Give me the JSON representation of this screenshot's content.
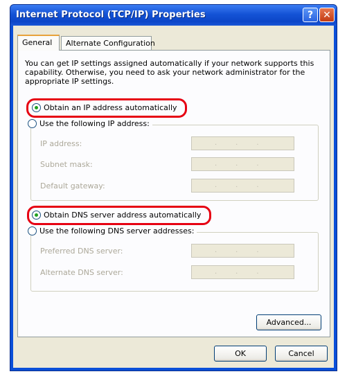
{
  "window": {
    "title": "Internet Protocol (TCP/IP) Properties",
    "help_label": "?",
    "close_label": "✕"
  },
  "tabs": [
    {
      "label": "General"
    },
    {
      "label": "Alternate Configuration"
    }
  ],
  "intro_text": "You can get IP settings assigned automatically if your network supports this capability. Otherwise, you need to ask your network administrator for the appropriate IP settings.",
  "ip_section": {
    "auto_option": "Obtain an IP address automatically",
    "manual_option": "Use the following IP address:",
    "auto_selected": true,
    "fields": [
      {
        "label": "IP address:",
        "value": "..."
      },
      {
        "label": "Subnet mask:",
        "value": "..."
      },
      {
        "label": "Default gateway:",
        "value": "..."
      }
    ]
  },
  "dns_section": {
    "auto_option": "Obtain DNS server address automatically",
    "manual_option": "Use the following DNS server addresses:",
    "auto_selected": true,
    "fields": [
      {
        "label": "Preferred DNS server:",
        "value": "..."
      },
      {
        "label": "Alternate DNS server:",
        "value": "..."
      }
    ]
  },
  "buttons": {
    "advanced": "Advanced...",
    "ok": "OK",
    "cancel": "Cancel"
  },
  "colors": {
    "titlebar": "#0a4fd8",
    "highlight": "#e60012",
    "dialog_bg": "#ece9d8"
  }
}
